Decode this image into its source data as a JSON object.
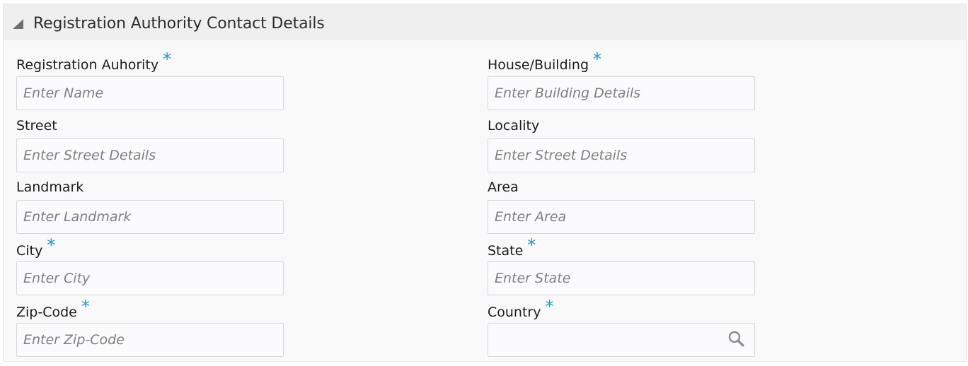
{
  "section": {
    "title": "Registration Authority Contact Details",
    "required_marker": "*"
  },
  "fields": {
    "registration_authority": {
      "label": "Registration Auhority",
      "placeholder": "Enter Name",
      "required": true
    },
    "house_building": {
      "label": "House/Building",
      "placeholder": "Enter Building Details",
      "required": true
    },
    "street": {
      "label": "Street",
      "placeholder": "Enter Street Details",
      "required": false
    },
    "locality": {
      "label": "Locality",
      "placeholder": "Enter Street Details",
      "required": false
    },
    "landmark": {
      "label": "Landmark",
      "placeholder": "Enter Landmark",
      "required": false
    },
    "area": {
      "label": "Area",
      "placeholder": "Enter Area",
      "required": false
    },
    "city": {
      "label": "City",
      "placeholder": "Enter City",
      "required": true
    },
    "state": {
      "label": "State",
      "placeholder": "Enter State",
      "required": true
    },
    "zip_code": {
      "label": "Zip-Code",
      "placeholder": "Enter Zip-Code",
      "required": true
    },
    "country": {
      "label": "Country",
      "placeholder": "",
      "required": true,
      "action_icon": "search-icon"
    }
  },
  "colors": {
    "required_star": "#2c93c6",
    "header_bg": "#efefef",
    "panel_bg": "#f9f9f9"
  }
}
